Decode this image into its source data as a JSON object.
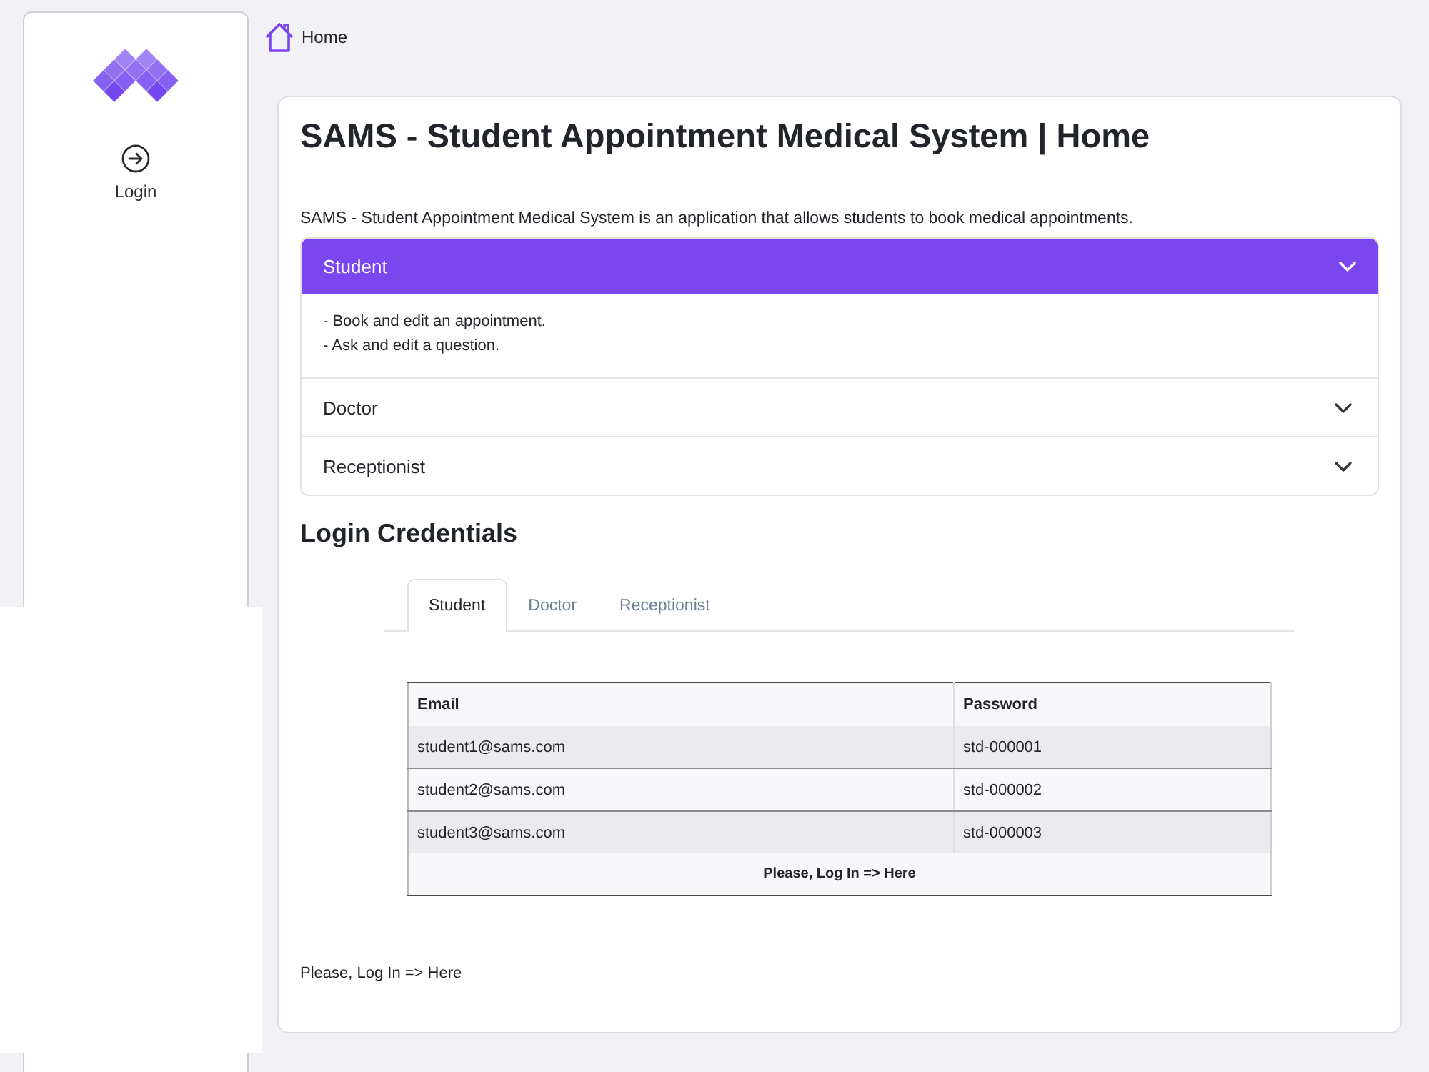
{
  "sidebar": {
    "items": [
      {
        "label": "Login"
      }
    ]
  },
  "breadcrumb": {
    "label": "Home"
  },
  "card": {
    "title": "SAMS - Student Appointment Medical System | Home",
    "description": "SAMS - Student Appointment Medical System is an application that allows students to book medical appointments.",
    "accordion": [
      {
        "label": "Student",
        "expanded": true,
        "lines": [
          "- Book and edit an appointment.",
          "- Ask and edit a question."
        ]
      },
      {
        "label": "Doctor",
        "expanded": false
      },
      {
        "label": "Receptionist",
        "expanded": false
      }
    ],
    "credentials": {
      "heading": "Login Credentials",
      "tabs": [
        {
          "label": "Student",
          "selected": true
        },
        {
          "label": "Doctor",
          "selected": false
        },
        {
          "label": "Receptionist",
          "selected": false
        }
      ],
      "table": {
        "columns": [
          "Email",
          "Password"
        ],
        "rows": [
          [
            "student1@sams.com",
            "std-000001"
          ],
          [
            "student2@sams.com",
            "std-000002"
          ],
          [
            "student3@sams.com",
            "std-000003"
          ]
        ],
        "footer": "Please, Log In => Here"
      }
    },
    "note": "Please, Log In => Here"
  }
}
